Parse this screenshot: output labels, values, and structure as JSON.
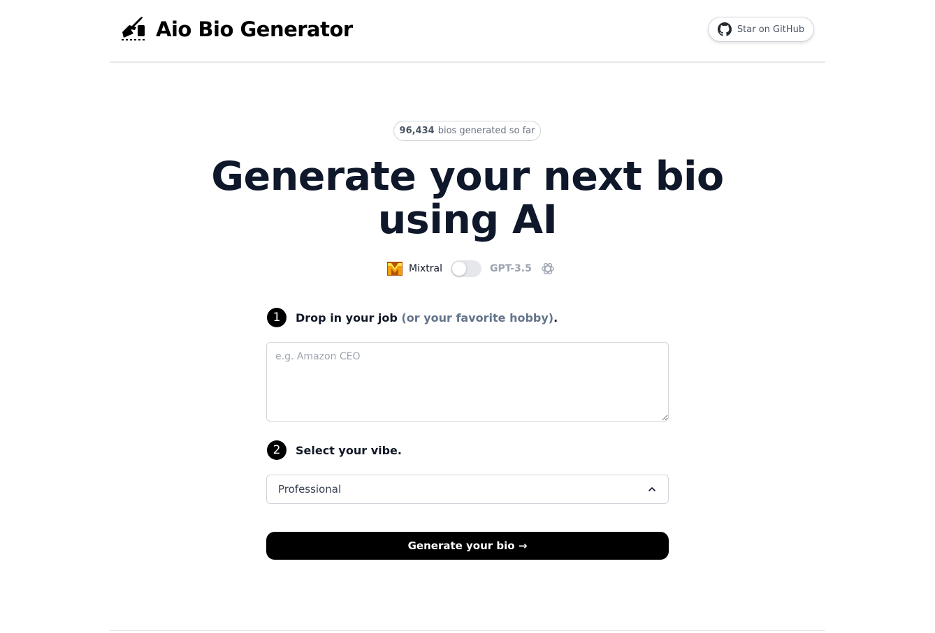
{
  "header": {
    "logo_icon": "writing-hand-icon",
    "title": "Aio Bio Generator",
    "github_button": {
      "icon": "github-icon",
      "label": "Star on GitHub"
    }
  },
  "counter": {
    "count": "96,434",
    "suffix": "bios generated so far"
  },
  "hero": {
    "line1": "Generate your next bio",
    "line2": "using AI"
  },
  "model_switch": {
    "option_a": {
      "icon": "mixtral-logo-icon",
      "label": "Mixtral"
    },
    "option_b": {
      "icon": "openai-logo-icon",
      "label": "GPT-3.5"
    },
    "selected": "Mixtral"
  },
  "step1": {
    "number": "1",
    "text": "Drop in your job",
    "hint": "(or your favorite hobby)",
    "end": "."
  },
  "job_input": {
    "placeholder": "e.g. Amazon CEO",
    "value": ""
  },
  "step2": {
    "number": "2",
    "text": "Select your vibe."
  },
  "vibe_select": {
    "value": "Professional",
    "icon": "chevron-up-icon"
  },
  "generate_button": {
    "label": "Generate your bio →"
  },
  "colors": {
    "primary": "#000000",
    "heading": "#0f172a",
    "muted": "#64748b",
    "border": "#d1d5db"
  }
}
